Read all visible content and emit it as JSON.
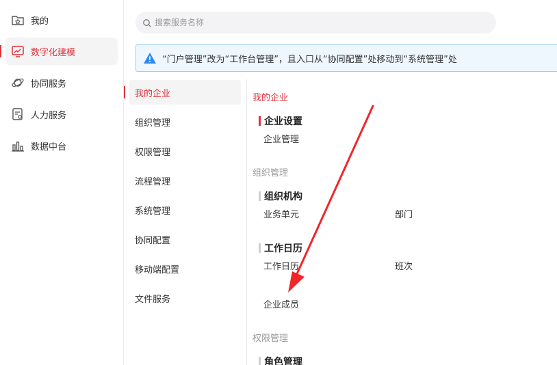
{
  "nav": {
    "items": [
      {
        "label": "我的",
        "icon": "folder-star-icon"
      },
      {
        "label": "数字化建模",
        "icon": "chart-monitor-icon",
        "active": true
      },
      {
        "label": "协同服务",
        "icon": "orbit-icon"
      },
      {
        "label": "人力服务",
        "icon": "id-card-icon"
      },
      {
        "label": "数据中台",
        "icon": "bar-chart-icon"
      }
    ]
  },
  "search": {
    "placeholder": "搜索服务名称"
  },
  "notice": {
    "text": "“门户管理”改为“工作台管理”，且入口从“协同配置”处移动到“系统管理”处"
  },
  "categories": [
    {
      "label": "我的企业",
      "active": true
    },
    {
      "label": "组织管理"
    },
    {
      "label": "权限管理"
    },
    {
      "label": "流程管理"
    },
    {
      "label": "系统管理"
    },
    {
      "label": "协同配置"
    },
    {
      "label": "移动端配置"
    },
    {
      "label": "文件服务"
    }
  ],
  "content": {
    "sections": [
      {
        "title": "我的企业",
        "groups": [
          {
            "title": "企业设置",
            "links": [
              "企业管理"
            ]
          }
        ]
      },
      {
        "title": "组织管理",
        "groups": [
          {
            "title": "组织机构",
            "links": [
              "业务单元",
              "部门"
            ]
          },
          {
            "title": "工作日历",
            "links": [
              "工作日历",
              "班次"
            ]
          },
          {
            "title": "",
            "links": [
              "企业成员"
            ]
          }
        ]
      },
      {
        "title": "权限管理",
        "groups": [
          {
            "title": "角色管理",
            "links": []
          }
        ]
      }
    ]
  },
  "colors": {
    "accent": "#e0303a",
    "notice_border": "#9ecbf3",
    "notice_bg": "#eef6fe",
    "warning_icon": "#2d8cf0"
  }
}
